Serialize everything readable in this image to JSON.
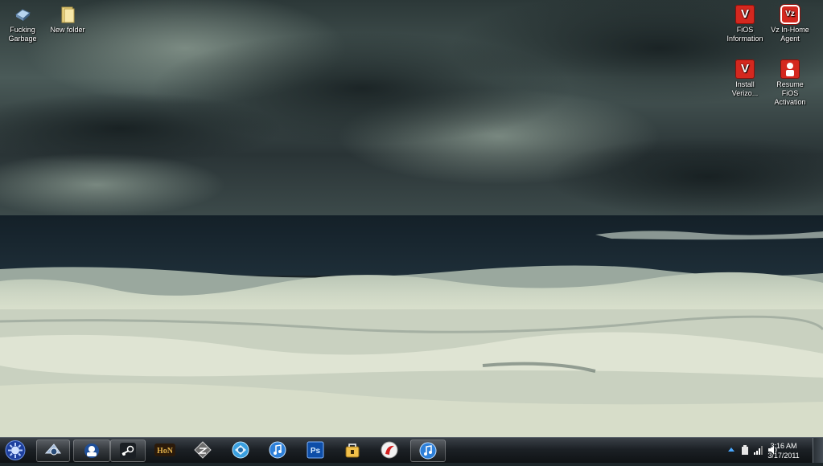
{
  "desktop": {
    "icons": [
      {
        "label": "Fucking Garbage",
        "icon": "recycle-bin-icon"
      },
      {
        "label": "New folder",
        "icon": "folder-icon"
      },
      {
        "label": "FiOS Information",
        "icon": "verizon-v-icon",
        "glyph": "V"
      },
      {
        "label": "Vz In-Home Agent",
        "icon": "vz-agent-icon",
        "glyph": "Vz"
      },
      {
        "label": "Install Verizo...",
        "icon": "verizon-v-icon",
        "glyph": "V"
      },
      {
        "label": "Resume FiOS Activation",
        "icon": "fios-activation-icon"
      }
    ]
  },
  "taskbar": {
    "pinned": [
      {
        "icon": "start-orb-icon"
      },
      {
        "icon": "app-magnifier-icon",
        "running": true
      },
      {
        "icon": "messenger-icon",
        "running": true
      },
      {
        "icon": "steam-icon",
        "running": true
      },
      {
        "icon": "hon-icon",
        "text": "HoN"
      },
      {
        "icon": "game-diamond-icon"
      },
      {
        "icon": "app-blue-circle-icon"
      },
      {
        "icon": "itunes-icon"
      },
      {
        "icon": "photoshop-icon",
        "text": "Ps"
      },
      {
        "icon": "bag-app-icon"
      },
      {
        "icon": "red-app-icon"
      },
      {
        "icon": "itunes-icon",
        "running": true
      }
    ],
    "tray": {
      "time": "3:16 AM",
      "date": "3/17/2011"
    }
  },
  "colors": {
    "taskbar": "#1c2126",
    "verizon_red": "#d4281f"
  }
}
